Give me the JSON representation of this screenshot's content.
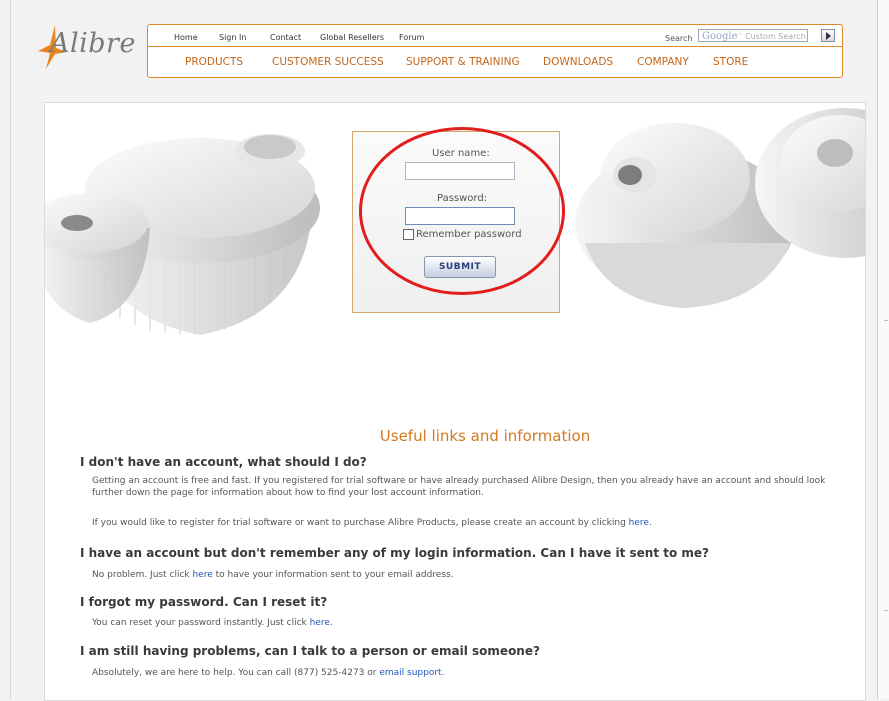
{
  "logo": {
    "text": "Alibre"
  },
  "nav": {
    "top_links": [
      "Home",
      "Sign In",
      "Contact",
      "Global Resellers",
      "Forum"
    ],
    "search_label": "Search",
    "search_placeholder_brand": "Google",
    "search_placeholder_text": "Custom Search",
    "main_links": [
      "PRODUCTS",
      "CUSTOMER SUCCESS",
      "SUPPORT & TRAINING",
      "DOWNLOADS",
      "COMPANY",
      "STORE"
    ]
  },
  "login": {
    "username_label": "User name:",
    "username_value": "",
    "password_label": "Password:",
    "password_value": "",
    "remember_label": "Remember password",
    "remember_checked": false,
    "submit_label": "SUBMIT"
  },
  "info": {
    "title": "Useful links and information",
    "faq": [
      {
        "question": "I don't have an account, what should I do?",
        "answer": "Getting an account is free and fast. If you registered for trial software or have already purchased Alibre Design, then you already have an account and should look further down the page for information about how to find your lost account information.",
        "answer2_pre": "If you would like to register for trial software or want to purchase Alibre Products, please create an account by clicking ",
        "answer2_link": "here",
        "answer2_post": "."
      },
      {
        "question": "I have an account but don't remember any of my login information. Can I have it sent to me?",
        "answer_pre": "No problem. Just click ",
        "answer_link": "here",
        "answer_post": " to have your information sent to your email address."
      },
      {
        "question": "I forgot my password. Can I reset it?",
        "answer_pre": "You can reset your password instantly. Just click ",
        "answer_link": "here",
        "answer_post": "."
      },
      {
        "question": "I am still having problems, can I talk to a person or email someone?",
        "answer_pre": "Absolutely, we are here to help. You can call (877) 525-4273 or ",
        "answer_link": "email support",
        "answer_post": "."
      }
    ]
  },
  "colors": {
    "accent": "#d3791f",
    "link": "#2158b8",
    "annotation": "#e21d1d"
  }
}
